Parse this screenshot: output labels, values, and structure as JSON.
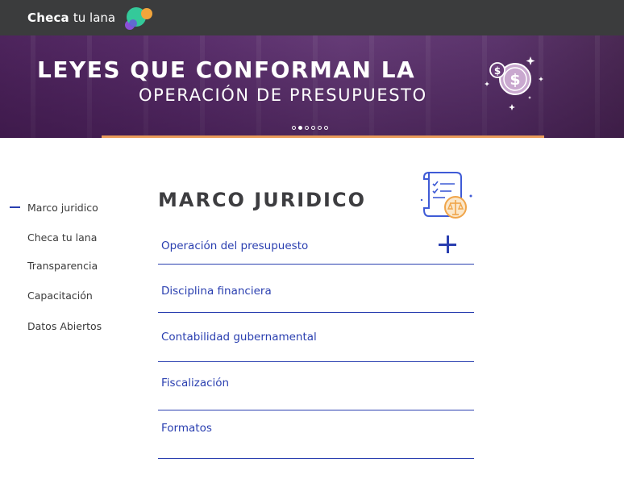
{
  "header": {
    "logo_bold": "Checa",
    "logo_light": "tu lana",
    "logo_icon": "colorful-bubbles-logo"
  },
  "hero": {
    "line1": "LEYES QUE CONFORMAN LA",
    "line2": "OPERACIÓN DE PRESUPUESTO",
    "icon": "dollar-coins-icon",
    "slide_count": 6,
    "active_slide": 2,
    "accent_color": "#e99b5a"
  },
  "sidebar": {
    "items": [
      {
        "label": "Marco juridico",
        "active": true
      },
      {
        "label": "Checa tu lana"
      },
      {
        "label": "Transparencia"
      },
      {
        "label": "Capacitación"
      },
      {
        "label": "Datos Abiertos"
      }
    ]
  },
  "main": {
    "title": "MARCO JURIDICO",
    "title_icon": "legal-document-scale-icon",
    "sections": [
      {
        "label": "Operación del presupuesto",
        "expand_icon": "plus-icon"
      },
      {
        "label": "Disciplina financiera"
      },
      {
        "label": "Contabilidad gubernamental"
      },
      {
        "label": "Fiscalización"
      },
      {
        "label": "Formatos"
      }
    ]
  },
  "colors": {
    "topbar": "#3b3c3d",
    "link_blue": "#2a3fb0",
    "heading": "#3d3d40"
  }
}
